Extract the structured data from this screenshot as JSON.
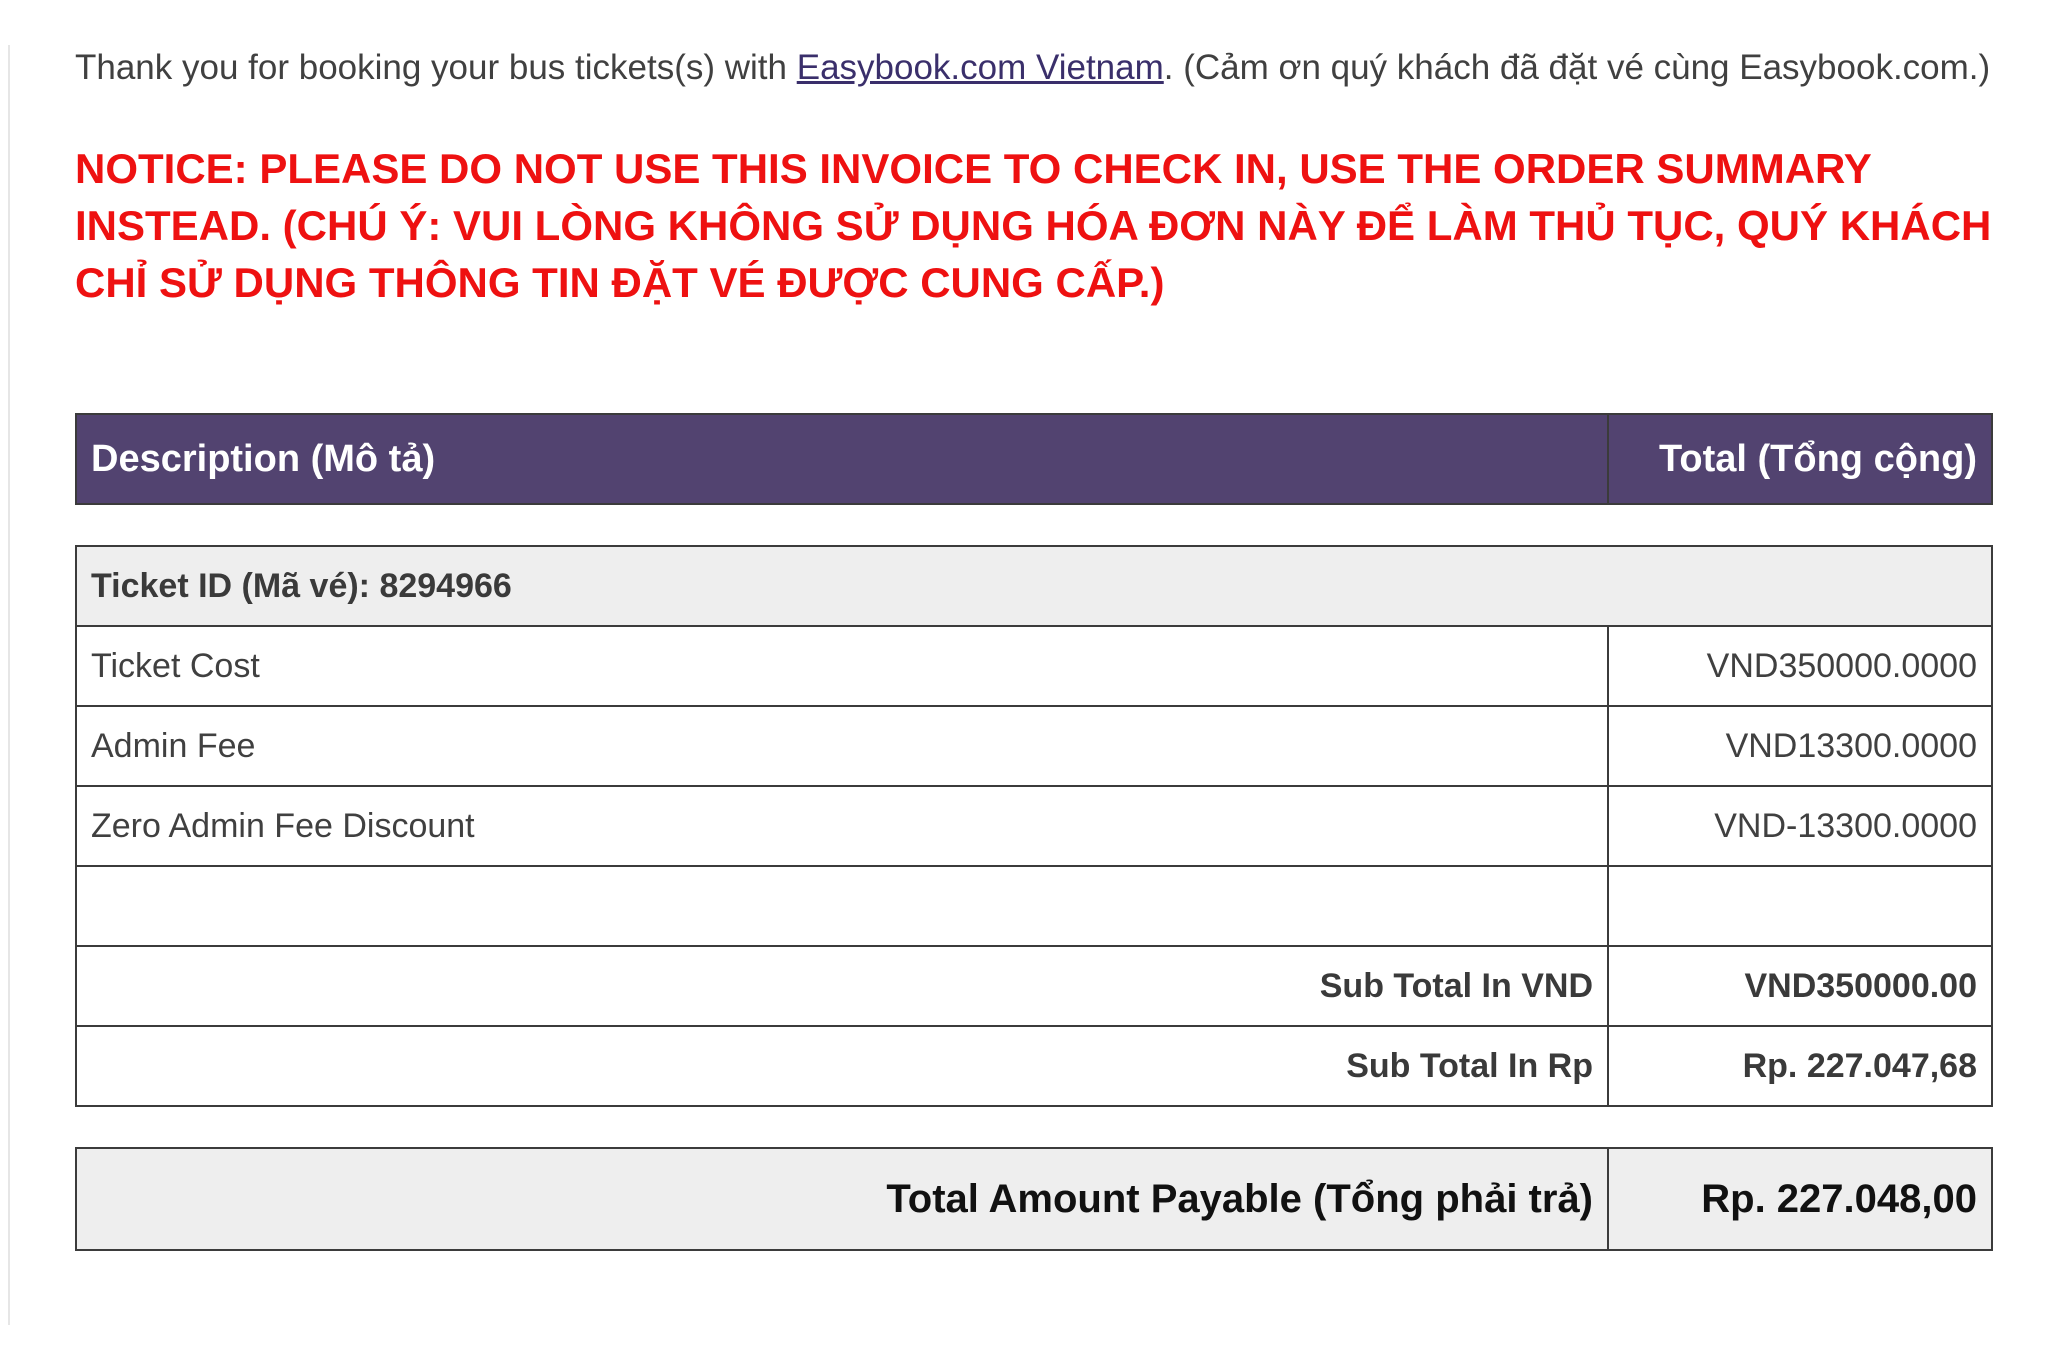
{
  "intro": {
    "text_before": "Thank you for booking your bus tickets(s) with ",
    "link_text": "Easybook.com Vietnam",
    "text_after": ". (Cảm ơn quý khách đã đặt vé cùng Easybook.com.)"
  },
  "notice": "NOTICE: PLEASE DO NOT USE THIS INVOICE TO CHECK IN, USE THE ORDER SUMMARY INSTEAD. (CHÚ Ý: VUI LÒNG KHÔNG SỬ DỤNG HÓA ĐƠN NÀY ĐỂ LÀM THỦ TỤC, QUÝ KHÁCH CHỈ SỬ DỤNG THÔNG TIN ĐẶT VÉ ĐƯỢC CUNG CẤP.)",
  "table_header": {
    "description": "Description (Mô tả)",
    "total": "Total (Tổng cộng)"
  },
  "ticket_group": {
    "label": "Ticket ID (Mã vé): 8294966"
  },
  "line_items": [
    {
      "description": "Ticket Cost",
      "amount": "VND350000.0000"
    },
    {
      "description": "Admin Fee",
      "amount": "VND13300.0000"
    },
    {
      "description": "Zero Admin Fee Discount",
      "amount": "VND-13300.0000"
    }
  ],
  "subtotals": {
    "vnd_label": "Sub Total In VND",
    "vnd_amount": "VND350000.00",
    "rp_label": "Sub Total In Rp",
    "rp_amount": "Rp. 227.047,68"
  },
  "grand_total": {
    "label": "Total Amount Payable (Tổng phải trả)",
    "amount": "Rp. 227.048,00"
  },
  "colors": {
    "header_bg": "#524370",
    "notice": "#ee1111",
    "link": "#3a2f6b",
    "row_shade": "#eeeeee"
  }
}
